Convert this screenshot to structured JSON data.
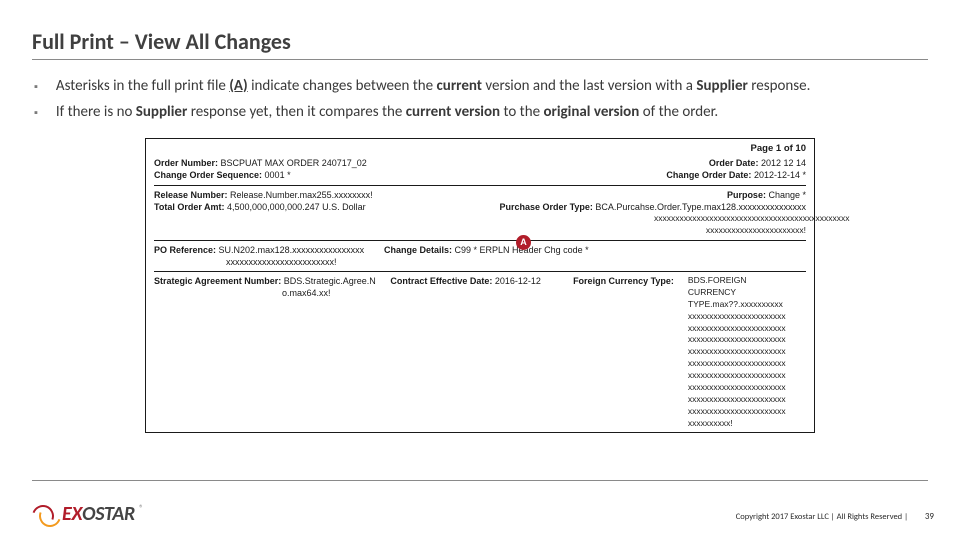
{
  "title": "Full Print – View All Changes",
  "bullets": [
    {
      "pre": "Asterisks in the full print file ",
      "u": "(A)",
      "post": " indicate changes between the ",
      "b1": "current",
      "mid": " version and the last version with a ",
      "b2": "Supplier",
      "end": " response."
    },
    {
      "pre": "If there is no ",
      "b1": "Supplier",
      "mid": " response yet, then it compares the ",
      "b2": "current version",
      "mid2": " to the ",
      "b3": "original version",
      "end": " of the order."
    }
  ],
  "doc": {
    "page_of": "Page 1 of  10",
    "order_number_label": "Order Number:",
    "order_number": "BSCPUAT MAX ORDER 240717_02",
    "order_date_label": "Order Date:",
    "order_date": "2012 12 14",
    "change_seq_label": "Change Order Sequence:",
    "change_seq": "0001 *",
    "change_date_label": "Change Order Date:",
    "change_date": "2012-12-14 *",
    "release_label": "Release Number:",
    "release": "Release.Number.max255.xxxxxxxx!",
    "purpose_label": "Purpose:",
    "purpose": "Change *",
    "total_label": "Total Order Amt:",
    "total": "4,500,000,000,000.247 U.S. Dollar",
    "po_type_label": "Purchase Order Type:",
    "po_type": "BCA.Purcahse.Order.Type.max128.xxxxxxxxxxxxxxx",
    "po_type_extra1": "xxxxxxxxxxxxxxxxxxxxxxxxxxxxxxxxxxxxxxxxxxxxxx",
    "po_type_extra2": "xxxxxxxxxxxxxxxxxxxxxxx!",
    "po_ref_label": "PO Reference:",
    "po_ref": "SU.N202.max128.xxxxxxxxxxxxxxxx",
    "po_ref_extra": "xxxxxxxxxxxxxxxxxxxxxxxx!",
    "change_details_label": "Change Details:",
    "change_details": "C99 * ERPLN Header Chg code *",
    "san_label": "Strategic Agreement Number:",
    "san1": "BDS.Strategic.Agree.N",
    "san2": "o.max64.xx!",
    "ced_label": "Contract Effective Date:",
    "ced": "2016-12-12",
    "fc_label": "Foreign Currency Type:",
    "fc_lines": [
      "BDS.FOREIGN",
      "CURRENCY",
      "TYPE.max??.xxxxxxxxxx",
      "xxxxxxxxxxxxxxxxxxxxxxx",
      "xxxxxxxxxxxxxxxxxxxxxxx",
      "xxxxxxxxxxxxxxxxxxxxxxx",
      "xxxxxxxxxxxxxxxxxxxxxxx",
      "xxxxxxxxxxxxxxxxxxxxxxx",
      "xxxxxxxxxxxxxxxxxxxxxxx",
      "xxxxxxxxxxxxxxxxxxxxxxx",
      "xxxxxxxxxxxxxxxxxxxxxxx",
      "xxxxxxxxxxxxxxxxxxxxxxx",
      "xxxxxxxxxx!"
    ]
  },
  "badge": "A",
  "logo": {
    "ex": "EX",
    "ost": "OSTAR",
    "reg": "®"
  },
  "footer": {
    "copyright": "Copyright 2017 Exostar LLC | All Rights Reserved |",
    "page": "39"
  }
}
